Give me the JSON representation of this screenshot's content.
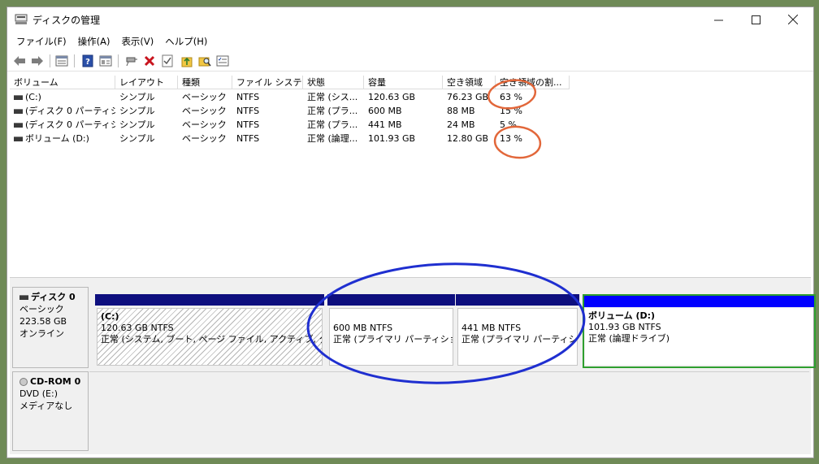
{
  "window": {
    "title": "ディスクの管理",
    "minimize_icon": "minimize-icon",
    "maximize_icon": "maximize-icon",
    "close_icon": "close-icon"
  },
  "menu": [
    {
      "label": "ファイル(F)"
    },
    {
      "label": "操作(A)"
    },
    {
      "label": "表示(V)"
    },
    {
      "label": "ヘルプ(H)"
    }
  ],
  "toolbar": [
    "back-arrow-icon",
    "forward-arrow-icon",
    "list-view-icon",
    "help-icon",
    "properties-view-icon",
    "connect-drive-icon",
    "delete-icon",
    "check-icon",
    "folder-up-icon",
    "search-folder-icon",
    "settings-list-icon"
  ],
  "columns": [
    {
      "label": "ボリューム"
    },
    {
      "label": "レイアウト"
    },
    {
      "label": "種類"
    },
    {
      "label": "ファイル システム"
    },
    {
      "label": "状態"
    },
    {
      "label": "容量"
    },
    {
      "label": "空き領域"
    },
    {
      "label": "空き領域の割..."
    }
  ],
  "volumes": [
    {
      "name": "(C:)",
      "layout": "シンプル",
      "type": "ベーシック",
      "fs": "NTFS",
      "status": "正常 (シス...",
      "capacity": "120.63 GB",
      "free": "76.23 GB",
      "free_pct": "63 %"
    },
    {
      "name": "(ディスク 0 パーティシ...",
      "layout": "シンプル",
      "type": "ベーシック",
      "fs": "NTFS",
      "status": "正常 (プラ...",
      "capacity": "600 MB",
      "free": "88 MB",
      "free_pct": "15 %"
    },
    {
      "name": "(ディスク 0 パーティシ...",
      "layout": "シンプル",
      "type": "ベーシック",
      "fs": "NTFS",
      "status": "正常 (プラ...",
      "capacity": "441 MB",
      "free": "24 MB",
      "free_pct": "5 %"
    },
    {
      "name": "ボリューム (D:)",
      "layout": "シンプル",
      "type": "ベーシック",
      "fs": "NTFS",
      "status": "正常 (論理...",
      "capacity": "101.93 GB",
      "free": "12.80 GB",
      "free_pct": "13 %"
    }
  ],
  "disks": [
    {
      "name": "ディスク 0",
      "type": "ベーシック",
      "size": "223.58 GB",
      "state": "オンライン"
    },
    {
      "name": "CD-ROM 0",
      "type": "DVD (E:)",
      "size": "",
      "state": "メディアなし"
    }
  ],
  "partitions": [
    {
      "title": "(C:)",
      "size": "120.63 GB NTFS",
      "status": "正常 (システム, ブート, ページ ファイル, アクティブ, クラッシュ"
    },
    {
      "title": "",
      "size": "600 MB NTFS",
      "status": "正常 (プライマリ パーティション)"
    },
    {
      "title": "",
      "size": "441 MB NTFS",
      "status": "正常 (プライマリ パーティション"
    },
    {
      "title": "ボリューム (D:)",
      "size": "101.93 GB NTFS",
      "status": "正常 (論理ドライブ)"
    }
  ],
  "colors": {
    "partition_bar": "#0e0f7e",
    "logical_bar": "#0000ff",
    "logical_border": "#2e9f2e",
    "annotation_orange": "#e2673a",
    "annotation_blue": "#1f2fd0"
  }
}
